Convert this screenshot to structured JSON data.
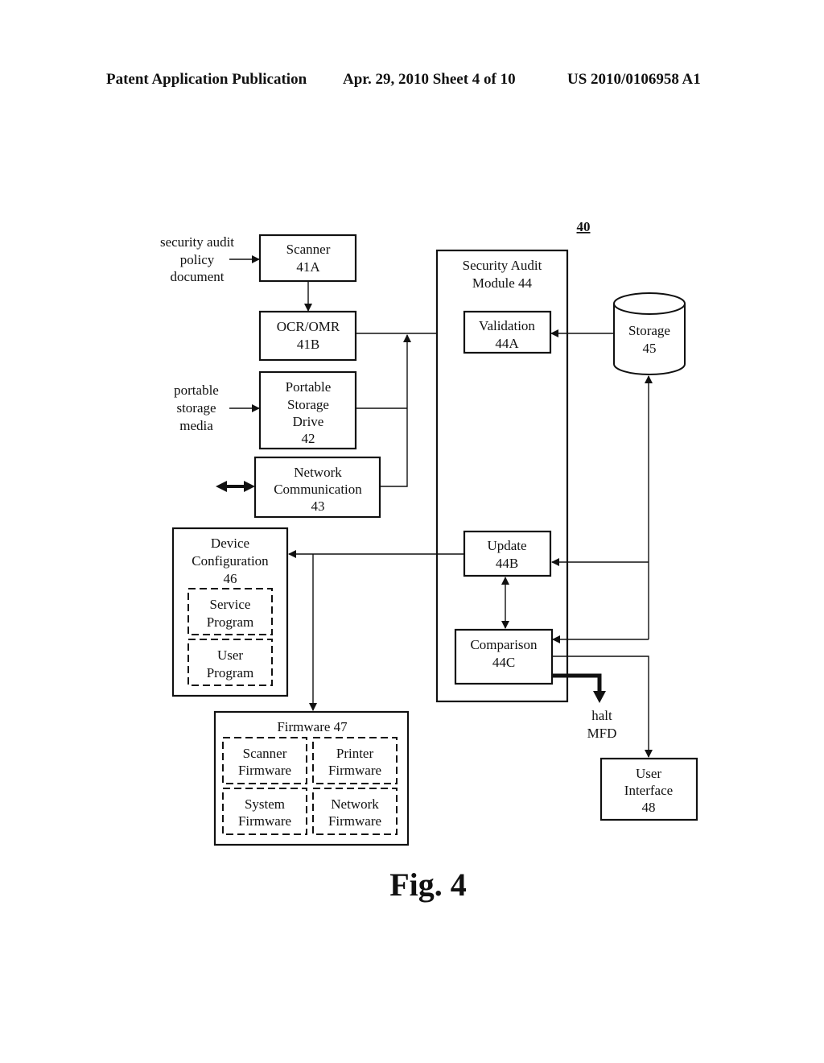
{
  "header": {
    "left": "Patent Application Publication",
    "middle": "Apr. 29, 2010  Sheet 4 of 10",
    "right": "US 2010/0106958 A1"
  },
  "figure": {
    "reference": "40",
    "caption": "Fig. 4"
  },
  "inputs": {
    "policy_doc": [
      "security audit",
      "policy",
      "document"
    ],
    "portable_media": [
      "portable",
      "storage",
      "media"
    ]
  },
  "blocks": {
    "scanner": [
      "Scanner",
      "41A"
    ],
    "ocr": [
      "OCR/OMR",
      "41B"
    ],
    "psd": [
      "Portable",
      "Storage",
      "Drive",
      "42"
    ],
    "netcomm": [
      "Network",
      "Communication",
      "43"
    ],
    "sam": [
      "Security Audit",
      "Module 44"
    ],
    "validation": [
      "Validation",
      "44A"
    ],
    "update": [
      "Update",
      "44B"
    ],
    "comparison": [
      "Comparison",
      "44C"
    ],
    "storage": [
      "Storage",
      "45"
    ],
    "devcfg": [
      "Device",
      "Configuration",
      "46"
    ],
    "service_prog": [
      "Service",
      "Program"
    ],
    "user_prog": [
      "User",
      "Program"
    ],
    "firmware": [
      "Firmware 47"
    ],
    "fw_scanner": [
      "Scanner",
      "Firmware"
    ],
    "fw_printer": [
      "Printer",
      "Firmware"
    ],
    "fw_system": [
      "System",
      "Firmware"
    ],
    "fw_network": [
      "Network",
      "Firmware"
    ],
    "ui": [
      "User",
      "Interface",
      "48"
    ]
  },
  "outputs": {
    "halt": [
      "halt",
      "MFD"
    ]
  }
}
